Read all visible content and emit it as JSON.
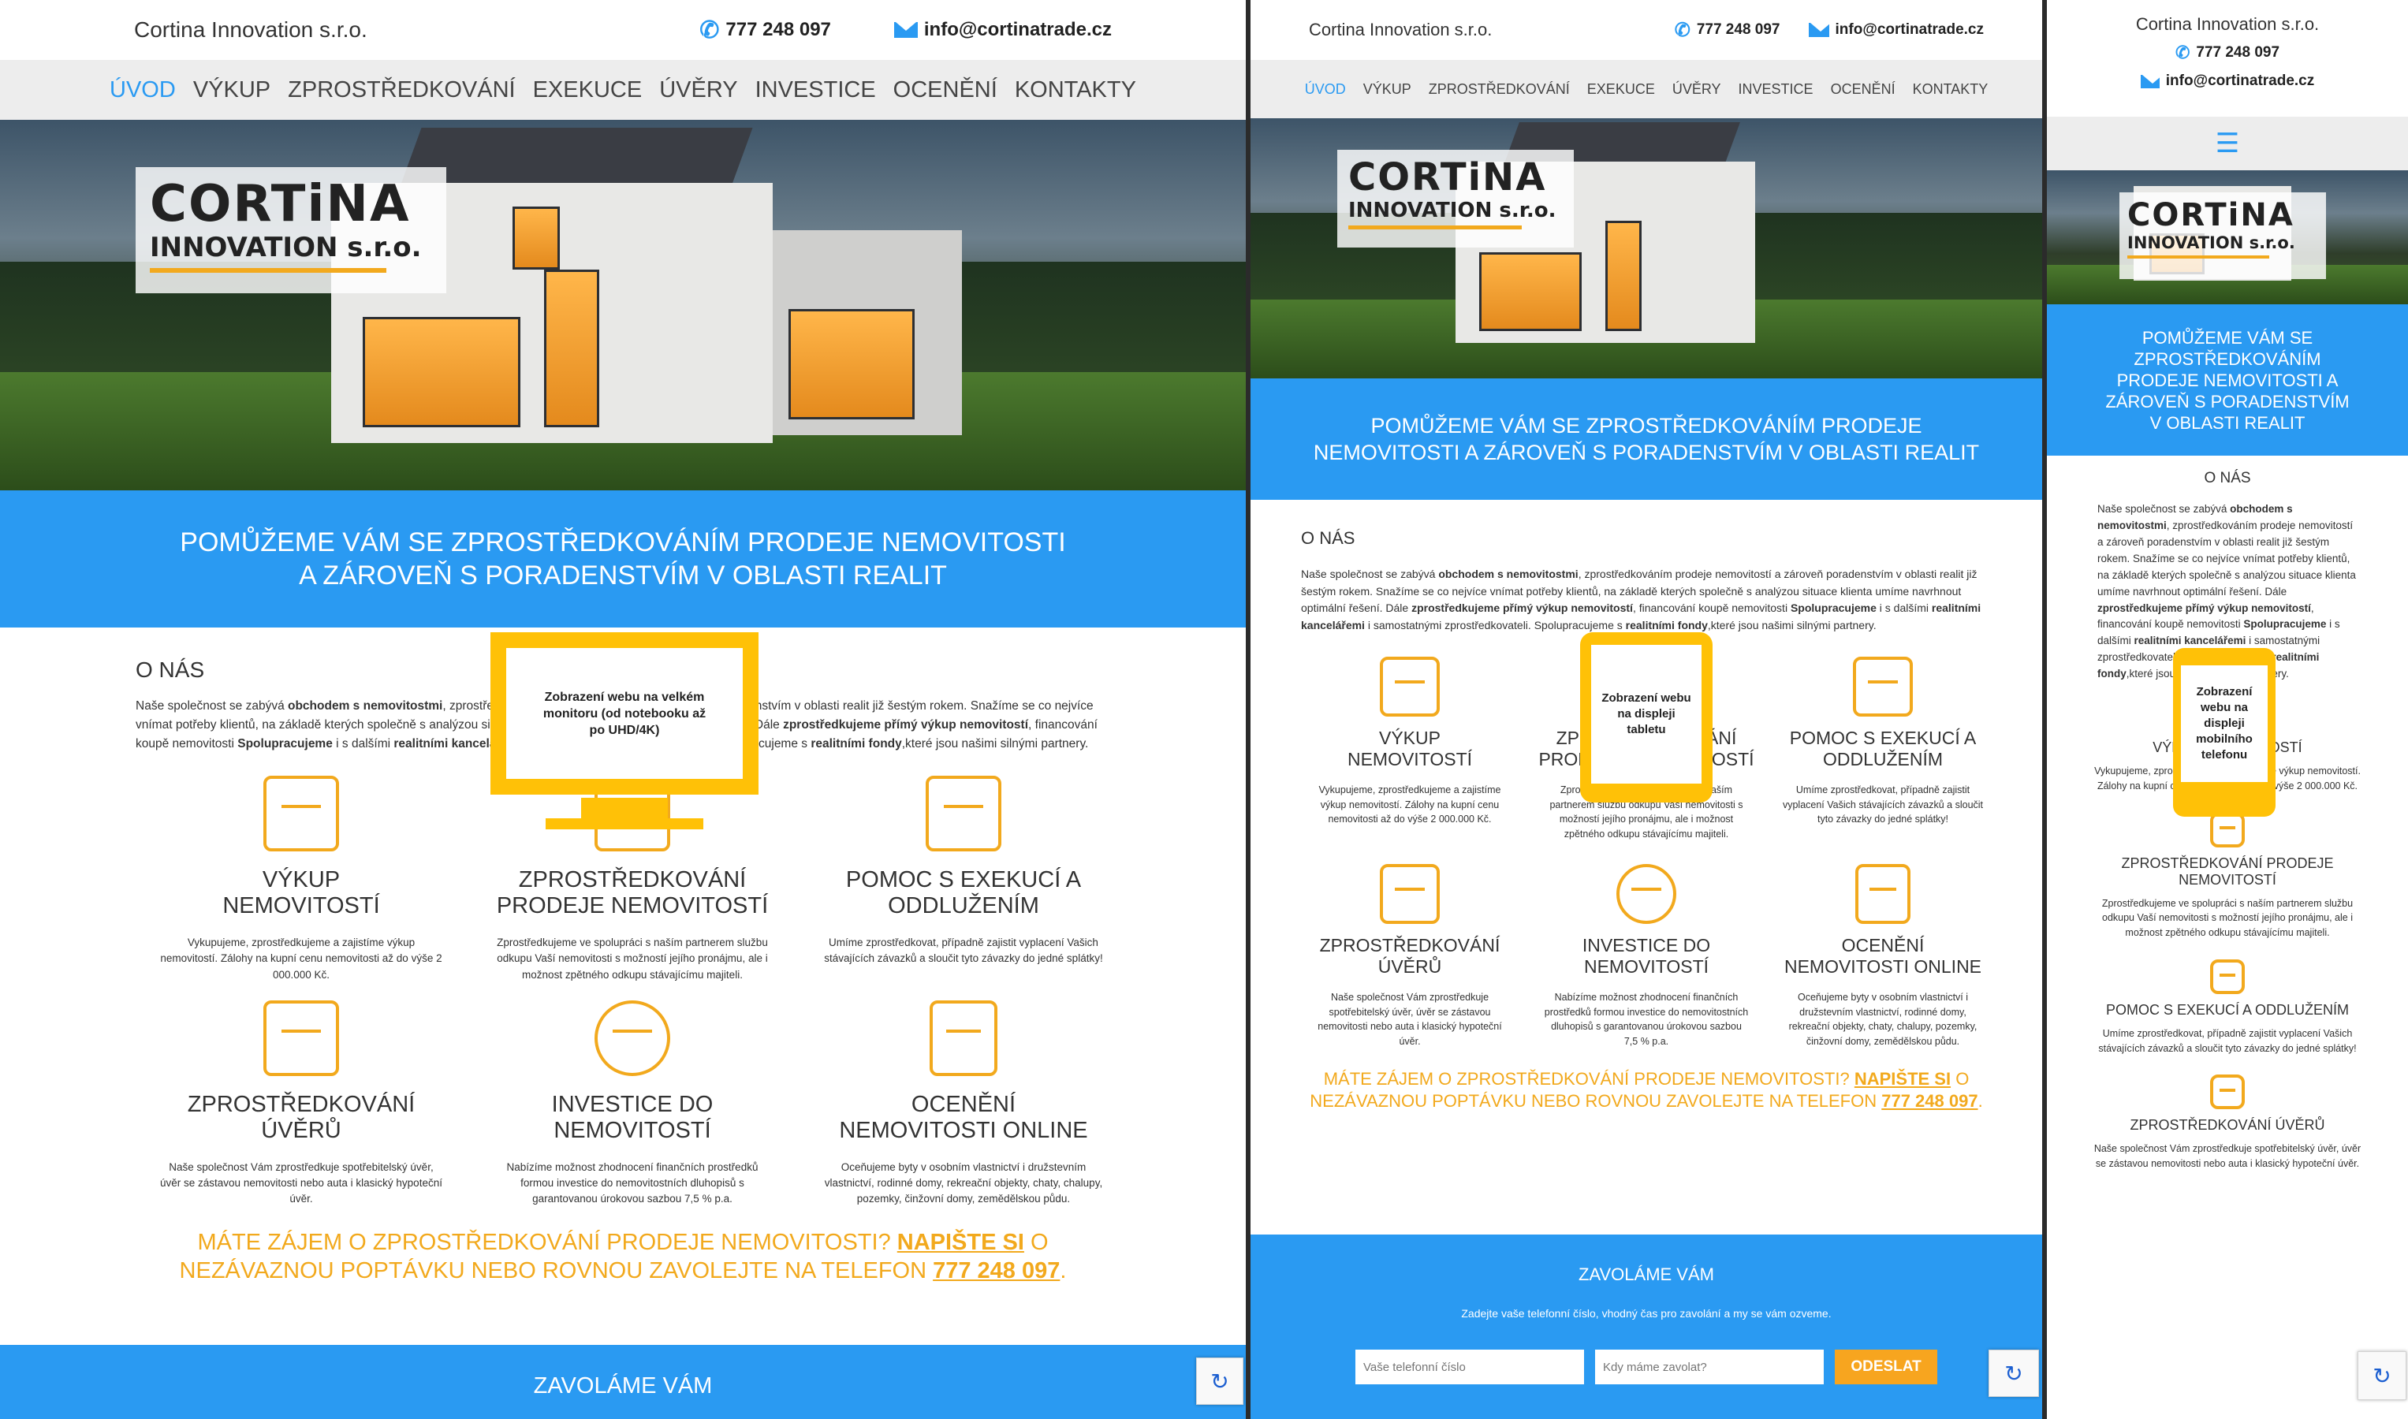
{
  "company": "Cortina Innovation s.r.o.",
  "phone": "777 248 097",
  "email": "info@cortinatrade.cz",
  "nav": [
    "ÚVOD",
    "VÝKUP",
    "ZPROSTŘEDKOVÁNÍ",
    "EXEKUCE",
    "ÚVĚRY",
    "INVESTICE",
    "OCENĚNÍ",
    "KONTAKTY"
  ],
  "logo": {
    "top": "CORTiNA",
    "bottom": "INNOVATION s.r.o."
  },
  "banner": "POMŮŽEME VÁM SE ZPROSTŘEDKOVÁNÍM PRODEJE NEMOVITOSTI A ZÁROVEŇ S PORADENSTVÍM V OBLASTI REALIT",
  "about": {
    "title": "O NÁS",
    "p1": "Naše společnost se zabývá ",
    "b1": "obchodem s nemovitostmi",
    "p2": ", zprostředkováním prodeje nemovitostí a zároveň poradenstvím v oblasti realit již šestým rokem. Snažíme se co nejvíce vnímat potřeby klientů, na základě kterých společně s analýzou situace klienta umíme navrhnout optimální řešení. Dále ",
    "b2": "zprostředkujeme přímý výkup nemovitostí",
    "p3": ", financování koupě nemovitosti ",
    "b3": "Spolupracujeme",
    "p4": " i s dalšími ",
    "b4": "realitními kancelářemi",
    "p5": " i samostatnými zprostředkovateli. Spolupracujeme s ",
    "b5": "realitními fondy",
    "p6": ",které jsou našimi silnými partnery."
  },
  "services": [
    {
      "title": "VÝKUP NEMOVITOSTÍ",
      "text": "Vykupujeme, zprostředkujeme a zajistíme výkup nemovitostí. Zálohy na kupní cenu nemovitosti až do výše 2 000.000 Kč."
    },
    {
      "title": "ZPROSTŘEDKOVÁNÍ PRODEJE NEMOVITOSTÍ",
      "text": "Zprostředkujeme ve spolupráci s naším partnerem službu odkupu Vaší nemovitosti s možností jejího pronájmu, ale i možnost zpětného odkupu stávajícímu majiteli."
    },
    {
      "title": "POMOC S EXEKUCÍ A ODDLUŽENÍM",
      "text": "Umíme zprostředkovat, případně zajistit vyplacení Vašich stávajících závazků a sloučit tyto závazky do jedné splátky!"
    },
    {
      "title": "ZPROSTŘEDKOVÁNÍ ÚVĚRŮ",
      "text": "Naše společnost Vám zprostředkuje spotřebitelský úvěr, úvěr se zástavou nemovitosti nebo auta i klasický hypoteční úvěr."
    },
    {
      "title": "INVESTICE DO NEMOVITOSTÍ",
      "text": "Nabízíme možnost zhodnocení finančních prostředků formou investice do nemovitostních dluhopisů s garantovanou úrokovou sazbou 7,5 % p.a."
    },
    {
      "title": "OCENĚNÍ NEMOVITOSTI ONLINE",
      "text": "Oceňujeme byty v osobním vlastnictví i družstevním vlastnictví, rodinné domy, rekreační objekty, chaty, chalupy, pozemky, činžovní domy, zemědělskou půdu."
    }
  ],
  "cta": {
    "a": "MÁTE ZÁJEM O ZPROSTŘEDKOVÁNÍ PRODEJE NEMOVITOSTI? ",
    "link": "NAPIŠTE SI",
    "b": " O NEZÁVAZNOU POPTÁVKU NEBO ROVNOU ZAVOLEJTE NA TELEFON ",
    "phone": " 777 248 097",
    "end": "."
  },
  "callback": {
    "title": "ZAVOLÁME VÁM",
    "subtitle": "Zadejte vaše telefonní číslo, vhodný čas pro zavolání a my se vám ozveme.",
    "phone_placeholder": "Vaše telefonní číslo",
    "time_placeholder": "Kdy máme zavolat?",
    "button": "ODESLAT"
  },
  "overlays": {
    "desktop": "Zobrazení webu na velkém monitoru (od notebooku až po UHD/4K)",
    "tablet": "Zobrazení webu na displeji tabletu",
    "mobile": "Zobrazení webu na displeji mobilního telefonu"
  },
  "colors": {
    "accent": "#2a9af2",
    "orange": "#f2a91d",
    "nav_bg": "#ededed"
  },
  "icons": [
    "phone-icon",
    "mail-icon",
    "house-sale-icon",
    "handshake-icon",
    "calculator-docs-icon",
    "meeting-icon",
    "pie-chart-icon",
    "checklist-icon",
    "menu-icon",
    "recaptcha-icon"
  ]
}
